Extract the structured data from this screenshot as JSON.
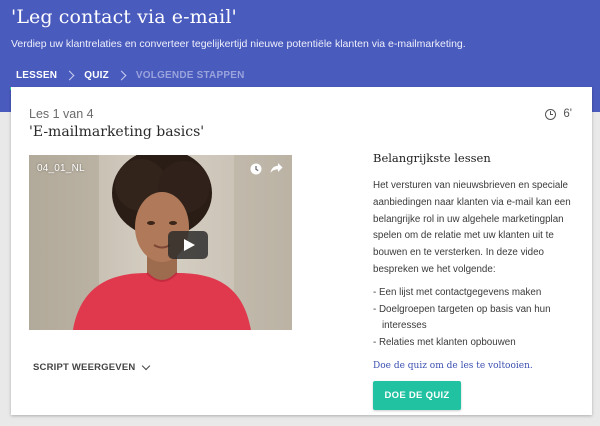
{
  "header": {
    "title": "'Leg contact via e-mail'",
    "subtitle": "Verdiep uw klantrelaties en converteer tegelijkertijd nieuwe potentiële klanten via e-mailmarketing.",
    "background": "#4a5bbe"
  },
  "breadcrumb": {
    "items": [
      {
        "label": "LESSEN",
        "state": "active"
      },
      {
        "label": "QUIZ",
        "state": "default"
      },
      {
        "label": "VOLGENDE STAPPEN",
        "state": "muted"
      }
    ]
  },
  "lesson": {
    "count": "Les 1 van 4",
    "title": "'E-mailmarketing basics'",
    "duration": "6'",
    "duration_icon": "clock-icon"
  },
  "video": {
    "label": "04_01_NL",
    "icons": [
      "watch-later-icon",
      "share-icon",
      "play-icon"
    ]
  },
  "script_toggle": {
    "label": "SCRIPT WEERGEVEN"
  },
  "side": {
    "heading": "Belangrijkste lessen",
    "text": "Het versturen van nieuwsbrieven en speciale aanbiedingen naar klanten via e-mail kan een belangrijke rol in uw algehele marketingplan spelen om de relatie met uw klanten uit te bouwen en te versterken. In deze video bespreken we het volgende:",
    "bullets": [
      "- Een lijst met contactgegevens maken",
      "- Doelgroepen targeten op basis van hun interesses",
      "- Relaties met klanten opbouwen"
    ]
  },
  "quiz": {
    "link": "Doe de quiz om de les te voltooien.",
    "button": "DOE DE QUIZ",
    "accent": "#21c2a2"
  }
}
